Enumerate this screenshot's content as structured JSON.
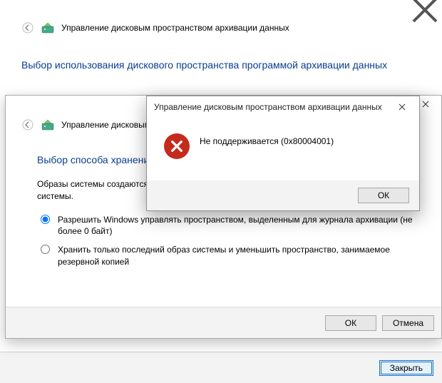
{
  "win1": {
    "title": "Управление дисковым пространством архивации данных",
    "instruction": "Выбор использования дискового пространства программой архивации данных"
  },
  "win2": {
    "title": "Управление дисковым пространством архивации данных",
    "instruction": "Выбор способа хранения",
    "body": "Образы системы создаются автоматически, чтобы можно было сохранить последний образ системы.",
    "radio1": "Разрешить Windows управлять пространством, выделенным для журнала архивации (не более 0 байт)",
    "radio2": "Хранить только последний образ системы и уменьшить пространство, занимаемое резервной копией",
    "ok": "ОК",
    "cancel": "Отмена"
  },
  "dialog": {
    "title": "Управление дисковым пространством архивации данных",
    "message": "Не поддерживается (0x80004001)",
    "ok": "ОК"
  },
  "footer": {
    "close": "Закрыть"
  }
}
